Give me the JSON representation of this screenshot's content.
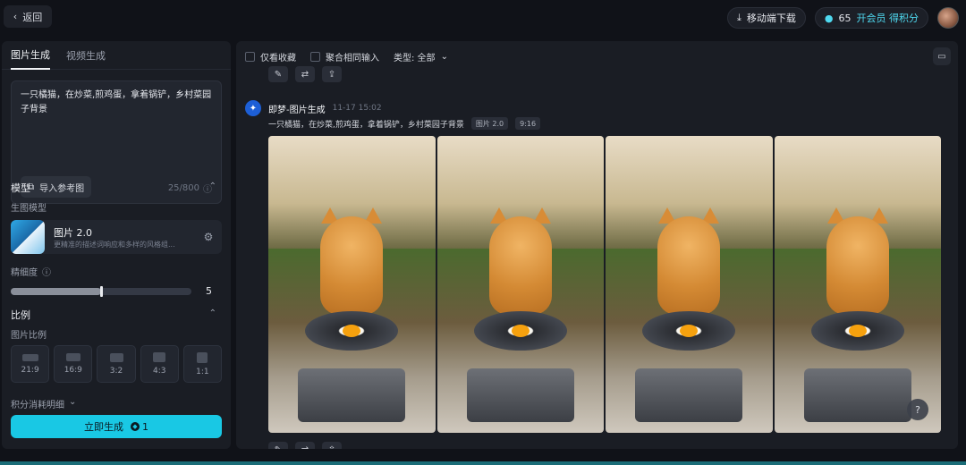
{
  "header": {
    "back_label": "返回",
    "download_label": "移动端下载",
    "credits": "65",
    "vip_label": "开会员 得积分"
  },
  "left": {
    "tabs": [
      {
        "label": "图片生成",
        "active": true
      },
      {
        "label": "视频生成",
        "active": false
      }
    ],
    "prompt": "一只橘猫，在炒菜,煎鸡蛋，拿着锅铲，乡村菜园子背景",
    "ref_button": "导入参考图",
    "char_count": "25/800",
    "model_section": "模型",
    "model_sub": "生图模型",
    "model_name": "图片 2.0",
    "model_desc": "更精准的描述词响应和多样的风格组...",
    "precision_label": "精细度",
    "precision_value": "5",
    "precision_level": 0.5,
    "ratio_section": "比例",
    "ratio_sub": "图片比例",
    "ratios": [
      "21:9",
      "16:9",
      "3:2",
      "4:3",
      "1:1"
    ],
    "cost_label": "积分消耗明细",
    "generate_label": "立即生成",
    "generate_cost": "1"
  },
  "right": {
    "filters": {
      "favorites": "仅看收藏",
      "merge": "聚合相同输入",
      "type": "类型: 全部"
    },
    "generation": {
      "title": "即梦-图片生成",
      "time": "11-17  15:02",
      "prompt": "一只橘猫，在炒菜,煎鸡蛋，拿着锅铲，乡村菜园子背景",
      "model_tag": "图片 2.0",
      "ratio_tag": "9:16"
    },
    "help": "?"
  },
  "colors": {
    "accent": "#19c8e4",
    "background": "#101218",
    "panel": "#1a1d24"
  }
}
